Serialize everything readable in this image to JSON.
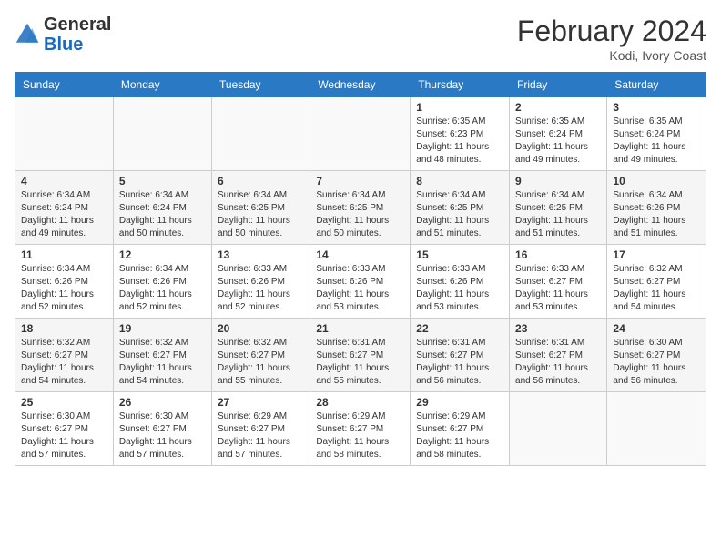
{
  "header": {
    "logo_general": "General",
    "logo_blue": "Blue",
    "month_year": "February 2024",
    "location": "Kodi, Ivory Coast"
  },
  "days_of_week": [
    "Sunday",
    "Monday",
    "Tuesday",
    "Wednesday",
    "Thursday",
    "Friday",
    "Saturday"
  ],
  "weeks": [
    [
      {
        "num": "",
        "info": ""
      },
      {
        "num": "",
        "info": ""
      },
      {
        "num": "",
        "info": ""
      },
      {
        "num": "",
        "info": ""
      },
      {
        "num": "1",
        "info": "Sunrise: 6:35 AM\nSunset: 6:23 PM\nDaylight: 11 hours\nand 48 minutes."
      },
      {
        "num": "2",
        "info": "Sunrise: 6:35 AM\nSunset: 6:24 PM\nDaylight: 11 hours\nand 49 minutes."
      },
      {
        "num": "3",
        "info": "Sunrise: 6:35 AM\nSunset: 6:24 PM\nDaylight: 11 hours\nand 49 minutes."
      }
    ],
    [
      {
        "num": "4",
        "info": "Sunrise: 6:34 AM\nSunset: 6:24 PM\nDaylight: 11 hours\nand 49 minutes."
      },
      {
        "num": "5",
        "info": "Sunrise: 6:34 AM\nSunset: 6:24 PM\nDaylight: 11 hours\nand 50 minutes."
      },
      {
        "num": "6",
        "info": "Sunrise: 6:34 AM\nSunset: 6:25 PM\nDaylight: 11 hours\nand 50 minutes."
      },
      {
        "num": "7",
        "info": "Sunrise: 6:34 AM\nSunset: 6:25 PM\nDaylight: 11 hours\nand 50 minutes."
      },
      {
        "num": "8",
        "info": "Sunrise: 6:34 AM\nSunset: 6:25 PM\nDaylight: 11 hours\nand 51 minutes."
      },
      {
        "num": "9",
        "info": "Sunrise: 6:34 AM\nSunset: 6:25 PM\nDaylight: 11 hours\nand 51 minutes."
      },
      {
        "num": "10",
        "info": "Sunrise: 6:34 AM\nSunset: 6:26 PM\nDaylight: 11 hours\nand 51 minutes."
      }
    ],
    [
      {
        "num": "11",
        "info": "Sunrise: 6:34 AM\nSunset: 6:26 PM\nDaylight: 11 hours\nand 52 minutes."
      },
      {
        "num": "12",
        "info": "Sunrise: 6:34 AM\nSunset: 6:26 PM\nDaylight: 11 hours\nand 52 minutes."
      },
      {
        "num": "13",
        "info": "Sunrise: 6:33 AM\nSunset: 6:26 PM\nDaylight: 11 hours\nand 52 minutes."
      },
      {
        "num": "14",
        "info": "Sunrise: 6:33 AM\nSunset: 6:26 PM\nDaylight: 11 hours\nand 53 minutes."
      },
      {
        "num": "15",
        "info": "Sunrise: 6:33 AM\nSunset: 6:26 PM\nDaylight: 11 hours\nand 53 minutes."
      },
      {
        "num": "16",
        "info": "Sunrise: 6:33 AM\nSunset: 6:27 PM\nDaylight: 11 hours\nand 53 minutes."
      },
      {
        "num": "17",
        "info": "Sunrise: 6:32 AM\nSunset: 6:27 PM\nDaylight: 11 hours\nand 54 minutes."
      }
    ],
    [
      {
        "num": "18",
        "info": "Sunrise: 6:32 AM\nSunset: 6:27 PM\nDaylight: 11 hours\nand 54 minutes."
      },
      {
        "num": "19",
        "info": "Sunrise: 6:32 AM\nSunset: 6:27 PM\nDaylight: 11 hours\nand 54 minutes."
      },
      {
        "num": "20",
        "info": "Sunrise: 6:32 AM\nSunset: 6:27 PM\nDaylight: 11 hours\nand 55 minutes."
      },
      {
        "num": "21",
        "info": "Sunrise: 6:31 AM\nSunset: 6:27 PM\nDaylight: 11 hours\nand 55 minutes."
      },
      {
        "num": "22",
        "info": "Sunrise: 6:31 AM\nSunset: 6:27 PM\nDaylight: 11 hours\nand 56 minutes."
      },
      {
        "num": "23",
        "info": "Sunrise: 6:31 AM\nSunset: 6:27 PM\nDaylight: 11 hours\nand 56 minutes."
      },
      {
        "num": "24",
        "info": "Sunrise: 6:30 AM\nSunset: 6:27 PM\nDaylight: 11 hours\nand 56 minutes."
      }
    ],
    [
      {
        "num": "25",
        "info": "Sunrise: 6:30 AM\nSunset: 6:27 PM\nDaylight: 11 hours\nand 57 minutes."
      },
      {
        "num": "26",
        "info": "Sunrise: 6:30 AM\nSunset: 6:27 PM\nDaylight: 11 hours\nand 57 minutes."
      },
      {
        "num": "27",
        "info": "Sunrise: 6:29 AM\nSunset: 6:27 PM\nDaylight: 11 hours\nand 57 minutes."
      },
      {
        "num": "28",
        "info": "Sunrise: 6:29 AM\nSunset: 6:27 PM\nDaylight: 11 hours\nand 58 minutes."
      },
      {
        "num": "29",
        "info": "Sunrise: 6:29 AM\nSunset: 6:27 PM\nDaylight: 11 hours\nand 58 minutes."
      },
      {
        "num": "",
        "info": ""
      },
      {
        "num": "",
        "info": ""
      }
    ]
  ]
}
